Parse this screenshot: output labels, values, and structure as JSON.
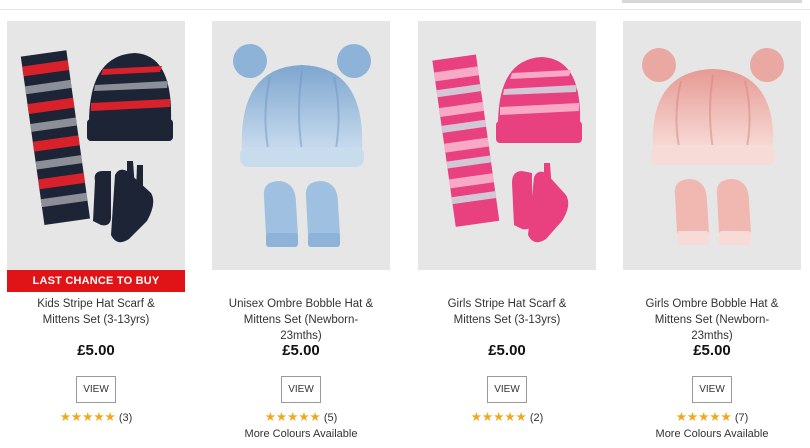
{
  "products": [
    {
      "badge": "LAST CHANCE TO BUY",
      "name_line1": "Kids Stripe Hat Scarf &",
      "name_line2": "Mittens Set (3-13yrs)",
      "name_line3": "",
      "price": "£5.00",
      "view_label": "VIEW",
      "stars": "★★★★★",
      "rating_value": 5,
      "review_count": "(3)",
      "more_colours": "",
      "colors": {
        "main": "#1c2436",
        "stripe1": "#d8212b",
        "stripe2": "#8c8f97"
      }
    },
    {
      "badge": "",
      "name_line1": "Unisex Ombre Bobble Hat &",
      "name_line2": "Mittens Set (Newborn-",
      "name_line3": "23mths)",
      "price": "£5.00",
      "view_label": "VIEW",
      "stars": "★★★★★",
      "rating_value": 5,
      "review_count": "(5)",
      "more_colours": "More Colours Available",
      "colors": {
        "main": "#9fc0e0",
        "light": "#c9dcee",
        "dark": "#7ea6cf"
      }
    },
    {
      "badge": "",
      "name_line1": "Girls Stripe Hat Scarf &",
      "name_line2": "Mittens Set (3-13yrs)",
      "name_line3": "",
      "price": "£5.00",
      "view_label": "VIEW",
      "stars": "★★★★★",
      "rating_value": 5,
      "review_count": "(2)",
      "more_colours": "",
      "colors": {
        "main": "#e9407f",
        "stripe1": "#f7a9c6",
        "stripe2": "#d3c7d6"
      }
    },
    {
      "badge": "",
      "name_line1": "Girls Ombre Bobble Hat &",
      "name_line2": "Mittens Set (Newborn-",
      "name_line3": "23mths)",
      "price": "£5.00",
      "view_label": "VIEW",
      "stars": "★★★★★",
      "rating_value": 5,
      "review_count": "(7)",
      "more_colours": "More Colours Available",
      "colors": {
        "main": "#f1b8b2",
        "light": "#f7dbd7",
        "dark": "#e79a94"
      }
    }
  ]
}
